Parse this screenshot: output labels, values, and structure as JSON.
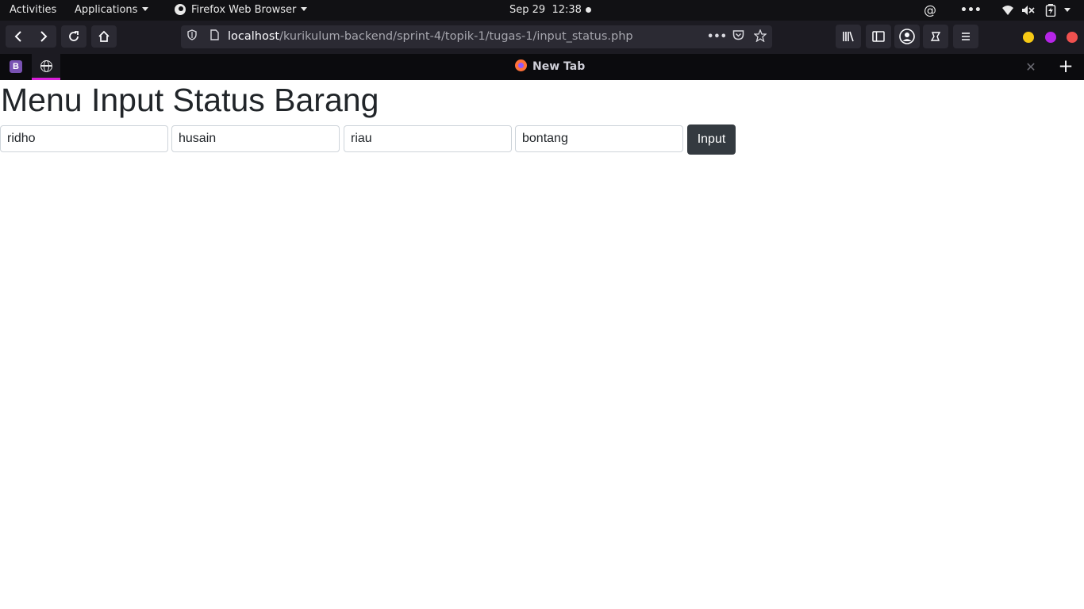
{
  "system_bar": {
    "activities": "Activities",
    "applications": "Applications",
    "app_menu": "Firefox Web Browser",
    "datetime": "Sep 29  12:38",
    "tray_icons": [
      "at-sign-icon",
      "more-icon",
      "wifi-icon",
      "volume-muted-icon",
      "battery-charging-icon",
      "system-menu-icon"
    ]
  },
  "browser": {
    "url_host": "localhost",
    "url_path": "/kurikulum-backend/sprint-4/topik-1/tugas-1/input_status.php",
    "tab_title": "New Tab",
    "pinned_tabs": [
      "bootstrap-icon",
      "globe-icon"
    ],
    "active_tab_accent": "#d91fd9",
    "window_controls": {
      "minimize_color": "#f6c915",
      "maximize_color": "#b625e8",
      "close_color": "#f0514f"
    }
  },
  "page": {
    "heading": "Menu Input Status Barang",
    "fields": [
      "ridho",
      "husain",
      "riau",
      "bontang"
    ],
    "submit_label": "Input"
  }
}
